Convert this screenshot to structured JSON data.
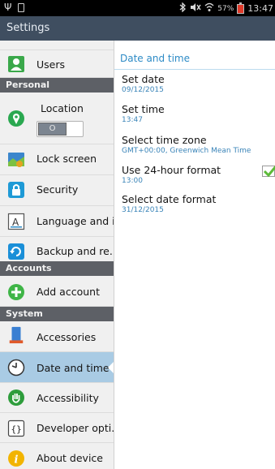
{
  "status_bar": {
    "battery_percent": "57%",
    "time": "13:47"
  },
  "title_bar": {
    "title": "Settings"
  },
  "sidebar": {
    "items": [
      {
        "label": "Users"
      },
      {
        "section": "Personal"
      },
      {
        "label": "Location",
        "toggle": "O"
      },
      {
        "label": "Lock screen"
      },
      {
        "label": "Security"
      },
      {
        "label": "Language and i.."
      },
      {
        "label": "Backup and re.."
      },
      {
        "section": "Accounts"
      },
      {
        "label": "Add account"
      },
      {
        "section": "System"
      },
      {
        "label": "Accessories"
      },
      {
        "label": "Date and time",
        "selected": true
      },
      {
        "label": "Accessibility"
      },
      {
        "label": "Developer opti.."
      },
      {
        "label": "About device"
      }
    ]
  },
  "main": {
    "header": "Date and time",
    "items": [
      {
        "title": "Set date",
        "summary": "09/12/2015"
      },
      {
        "title": "Set time",
        "summary": "13:47"
      },
      {
        "title": "Select time zone",
        "summary": "GMT+00:00, Greenwich Mean Time"
      },
      {
        "title": "Use 24-hour format",
        "summary": "13:00",
        "checked": true
      },
      {
        "title": "Select date format",
        "summary": "31/12/2015"
      }
    ]
  },
  "colors": {
    "title_bar": "#3f4e60",
    "section_header": "#5d6066",
    "selected_item": "#a9cbe4",
    "accent": "#2d8bc6",
    "checkmark": "#5dbb3a"
  }
}
